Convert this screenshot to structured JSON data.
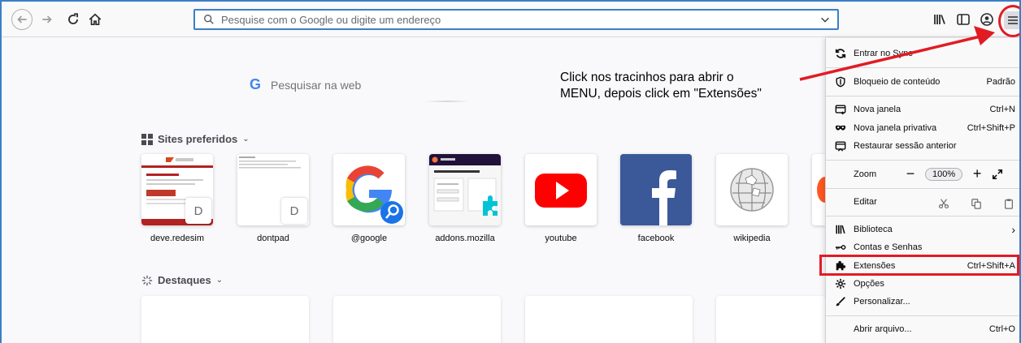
{
  "toolbar": {
    "url_placeholder": "Pesquise com o Google ou digite um endereço"
  },
  "newtab": {
    "search_label": "Pesquisar na web",
    "search_logo": "G",
    "top_sites_title": "Sites preferidos",
    "top_sites": [
      {
        "label": "deve.redesim",
        "badge": "D"
      },
      {
        "label": "dontpad",
        "badge": "D"
      },
      {
        "label": "@google",
        "badge": ""
      },
      {
        "label": "addons.mozilla",
        "badge": ""
      },
      {
        "label": "youtube",
        "badge": ""
      },
      {
        "label": "facebook",
        "badge": ""
      },
      {
        "label": "wikipedia",
        "badge": ""
      }
    ],
    "highlights_title": "Destaques"
  },
  "annotation": {
    "text": "Click nos tracinhos para abrir o\nMENU, depois click em \"Extensões\""
  },
  "menu": {
    "sync": "Entrar no Sync",
    "content_blocking": "Bloqueio de conteúdo",
    "content_blocking_value": "Padrão",
    "new_window": "Nova janela",
    "new_window_key": "Ctrl+N",
    "private_window": "Nova janela privativa",
    "private_window_key": "Ctrl+Shift+P",
    "restore_session": "Restaurar sessão anterior",
    "zoom": "Zoom",
    "zoom_value": "100%",
    "zoom_minus": "−",
    "zoom_plus": "+",
    "edit": "Editar",
    "library": "Biblioteca",
    "library_arrow": "›",
    "logins": "Contas e Senhas",
    "addons": "Extensões",
    "addons_key": "Ctrl+Shift+A",
    "options": "Opções",
    "customize": "Personalizar...",
    "open_file": "Abrir arquivo...",
    "open_file_key": "Ctrl+O"
  },
  "colors": {
    "annotation_red": "#e21b23",
    "url_focus": "#3b7fc4"
  }
}
